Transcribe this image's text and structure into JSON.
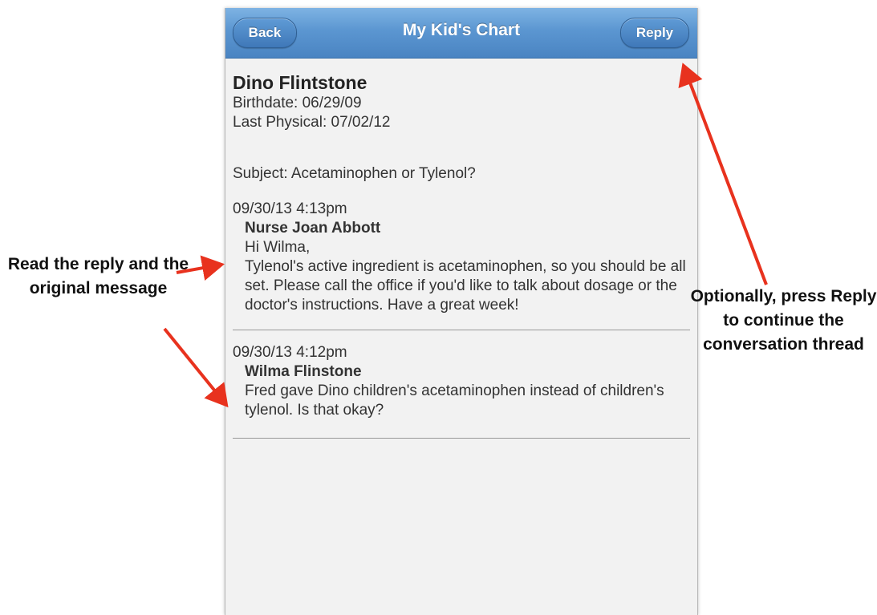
{
  "nav": {
    "back_label": "Back",
    "title": "My Kid's Chart",
    "reply_label": "Reply",
    "bar_color": "#5b96d1"
  },
  "patient": {
    "name": "Dino Flintstone",
    "birthdate": "Birthdate: 06/29/09",
    "last_physical": "Last Physical: 07/02/12"
  },
  "subject": "Subject: Acetaminophen or Tylenol?",
  "messages": [
    {
      "date": "09/30/13 4:13pm",
      "sender": "Nurse Joan Abbott",
      "greeting": "Hi Wilma,",
      "text": "Tylenol's active ingredient is acetaminophen, so you should be all set. Please call the office if you'd like to talk about dosage or the doctor's instructions. Have a great week!"
    },
    {
      "date": "09/30/13 4:12pm",
      "sender": "Wilma Flinstone",
      "text": "Fred gave Dino children's acetaminophen instead of children's tylenol. Is that okay?"
    }
  ],
  "annotations": {
    "left": "Read the reply and the original message",
    "right": "Optionally, press Reply to continue the conversation thread",
    "arrow_color": "#e8321e"
  }
}
